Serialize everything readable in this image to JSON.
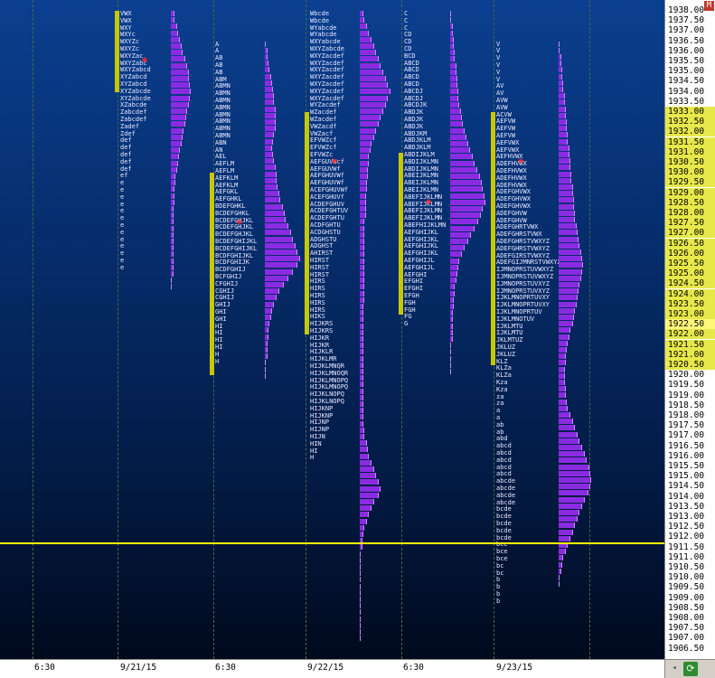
{
  "price_axis": {
    "labels": [
      "1938.00",
      "1937.50",
      "1937.00",
      "1936.50",
      "1936.00",
      "1935.50",
      "1935.00",
      "1934.50",
      "1934.00",
      "1933.50",
      "1933.00",
      "1932.50",
      "1932.00",
      "1931.50",
      "1931.00",
      "1930.50",
      "1930.00",
      "1929.50",
      "1929.00",
      "1928.50",
      "1928.00",
      "1927.50",
      "1927.00",
      "1926.50",
      "1926.00",
      "1925.50",
      "1925.00",
      "1924.50",
      "1924.00",
      "1923.50",
      "1923.00",
      "1922.50",
      "1922.00",
      "1921.50",
      "1921.00",
      "1920.50",
      "1920.00",
      "1919.50",
      "1919.00",
      "1918.50",
      "1918.00",
      "1917.50",
      "1917.00",
      "1916.50",
      "1916.00",
      "1915.50",
      "1915.00",
      "1914.50",
      "1914.00",
      "1913.50",
      "1913.00",
      "1912.50",
      "1912.00",
      "1911.50",
      "1911.00",
      "1910.50",
      "1910.00",
      "1909.50",
      "1909.00",
      "1908.50",
      "1908.00",
      "1907.50",
      "1907.00",
      "1906.50"
    ],
    "highlight_range": [
      "1933.00",
      "1920.50"
    ],
    "current_price": "1922.50",
    "max": 1938.0,
    "step": 0.5
  },
  "time_axis": {
    "labels": [
      "6:30",
      "9/21/15",
      "6:30",
      "9/22/15",
      "6:30",
      "9/23/15"
    ]
  },
  "toolbar": {
    "menu_icon_label": "M"
  },
  "colors": {
    "profile": "#8a2be2",
    "value_area": "#c8c800",
    "last_price": "#ffff00",
    "marker": "#ff3030"
  },
  "last_trade_line_price": 1911.75,
  "sessions": [
    {
      "letters": [
        "VWX",
        "VWX",
        "WXY",
        "WXYc",
        "WXYZc",
        "WXYZc",
        "WXYZac",
        "WXYZabc",
        "WXYZabcd",
        "XYZabcd",
        "XYZabcd",
        "XYZabcde",
        "XYZabcde",
        "XZabcde",
        "Zabcdef",
        "Zabcdef",
        "Zadef",
        "Zdef",
        "def",
        "def",
        "def",
        "def",
        "def",
        "ef",
        "e",
        "e",
        "e",
        "e",
        "e",
        "e",
        "e",
        "e",
        "e",
        "e",
        "e",
        "e",
        "e"
      ],
      "top": 1938.0,
      "va_high": 1938.0,
      "va_low": 1934.0,
      "profile": [
        3,
        3,
        5,
        6,
        8,
        9,
        10,
        12,
        14,
        15,
        15,
        16,
        17,
        16,
        15,
        14,
        13,
        12,
        11,
        10,
        9,
        8,
        7,
        6,
        5,
        4,
        4,
        3,
        3,
        3,
        2,
        2,
        2,
        2,
        2,
        2,
        2,
        2,
        2,
        2,
        2,
        1,
        1
      ]
    },
    {
      "letters": [
        "A",
        "A",
        "AB",
        "AB",
        "AB",
        "ABM",
        "ABMN",
        "ABMN",
        "ABMN",
        "ABMN",
        "ABMN",
        "ABMN",
        "ABMN",
        "ABMN",
        "ABN",
        "AN",
        "AEL",
        "AEFLM",
        "AEFLM",
        "AEFKLM",
        "AEFKLM",
        "AEFGKL",
        "AEFGHKL",
        "BDEFGHKL",
        "BCDEFGHKL",
        "BCDEFGHJKL",
        "BCDEFGHJKL",
        "BCDEFGHJKL",
        "BCDEFGHIJKL",
        "BCDEFGHIJKL",
        "BCDFGHIJKL",
        "BCDFGHIJK",
        "BCDFGHIJ",
        "BCFGHIJ",
        "CFGHIJ",
        "CGHIJ",
        "CGHIJ",
        "GHIJ",
        "GHI",
        "GHI",
        "HI",
        "HI",
        "HI",
        "HI",
        "H",
        "H"
      ],
      "top": 1936.5,
      "va_high": 1930.0,
      "va_low": 1920.0,
      "profile": [
        1,
        2,
        2,
        3,
        4,
        5,
        6,
        7,
        8,
        8,
        9,
        9,
        9,
        9,
        8,
        7,
        6,
        7,
        8,
        9,
        10,
        10,
        11,
        12,
        13,
        15,
        17,
        18,
        20,
        22,
        24,
        26,
        28,
        30,
        28,
        24,
        20,
        16,
        12,
        10,
        8,
        6,
        5,
        4,
        3,
        3,
        2,
        2,
        2,
        1,
        1,
        1
      ]
    },
    {
      "letters": [
        "Wbcde",
        "Wbcde",
        "WYabcde",
        "WYabcde",
        "WXYabcde",
        "WXYZabcde",
        "WXYZacdef",
        "WXYZacdef",
        "WXYZacdef",
        "WXYZacdef",
        "WXYZacdef",
        "WXYZacdef",
        "WXYZacdef",
        "WYZacdef",
        "WZacdef",
        "WZacdef",
        "VWZacdf",
        "VWZacf",
        "EFVWZcf",
        "EFVWZcf",
        "EFVWZc",
        "AEFGUVWcf",
        "AEFGUVWf",
        "AEFGHUVWf",
        "AEFGHUVWf",
        "ACEFGHUVWf",
        "ACEFGHUVf",
        "ACDEFGHUV",
        "ACDEFGHTUV",
        "ACDEFGHTU",
        "ACDFGHTU",
        "ACDGHSTU",
        "ADGHSTU",
        "ADGHST",
        "AHIRST",
        "HIRST",
        "HIRST",
        "HIRST",
        "HIRS",
        "HIRS",
        "HIRS",
        "HIRS",
        "HIRS",
        "HIKS",
        "HIJKRS",
        "HIJKRS",
        "HIJKR",
        "HIJKR",
        "HIJKLR",
        "HIJKLMR",
        "HIJKLMNQR",
        "HIJKLMNOQR",
        "HIJKLMNOPQ",
        "HIJKLMNOPQ",
        "HIJKLNOPQ",
        "HIJKLNOPQ",
        "HIJKNP",
        "HIJKNP",
        "HIJNP",
        "HIJNP",
        "HIJN",
        "HIN",
        "HI",
        "H"
      ],
      "top": 1938.0,
      "va_high": 1933.0,
      "va_low": 1922.0,
      "profile": [
        3,
        4,
        6,
        8,
        10,
        12,
        14,
        16,
        18,
        20,
        22,
        24,
        26,
        24,
        22,
        20,
        18,
        16,
        14,
        12,
        10,
        9,
        8,
        8,
        7,
        7,
        6,
        6,
        5,
        5,
        5,
        5,
        4,
        4,
        4,
        4,
        4,
        4,
        4,
        4,
        4,
        4,
        4,
        4,
        4,
        3,
        3,
        3,
        3,
        3,
        3,
        3,
        3,
        3,
        3,
        3,
        3,
        3,
        3,
        3,
        3,
        3,
        3,
        3,
        4,
        4,
        6,
        7,
        8,
        10,
        12,
        14,
        16,
        18,
        16,
        12,
        10,
        8,
        6,
        4,
        3,
        2,
        2,
        1,
        1,
        1,
        1,
        1,
        1,
        1,
        1,
        1,
        1,
        1,
        1,
        1,
        1
      ]
    },
    {
      "letters": [
        "C",
        "C",
        "C",
        "CD",
        "CD",
        "CD",
        "BCD",
        "ABCD",
        "ABCD",
        "ABCD",
        "ABCD",
        "ABCDJ",
        "ABCDJ",
        "ABCDJK",
        "ABDJK",
        "ABDJK",
        "ABDJK",
        "ABDJKM",
        "ABDJKLM",
        "ABDJKLM",
        "ABDIJKLM",
        "ABDIJKLMN",
        "ABDIJKLMN",
        "ABEIJKLMN",
        "ABEIJKLMN",
        "ABEIJKLMN",
        "ABEFIJKLMN",
        "ABEFIJKLMN",
        "ABEFIJKLMN",
        "ABEFIJKLMN",
        "ABEFHIJKLMN",
        "AEFGHIJKL",
        "AEFGHIJKL",
        "AEFGHIJKL",
        "AEFGHIJKL",
        "AEFGHIJL",
        "AEFGHIJL",
        "AEFGHI",
        "EFGHI",
        "EFGHI",
        "EFGH",
        "FGH",
        "FGH",
        "FG",
        "G"
      ],
      "top": 1938.0,
      "va_high": 1931.0,
      "va_low": 1923.0,
      "profile": [
        1,
        1,
        2,
        2,
        3,
        3,
        4,
        4,
        5,
        5,
        6,
        6,
        7,
        7,
        8,
        9,
        10,
        11,
        12,
        14,
        15,
        17,
        19,
        21,
        23,
        25,
        27,
        28,
        29,
        30,
        28,
        26,
        24,
        21,
        18,
        15,
        12,
        10,
        8,
        7,
        6,
        5,
        4,
        4,
        3,
        3,
        2,
        2,
        2,
        2,
        2,
        1,
        1,
        1,
        1,
        1
      ]
    },
    {
      "letters": [
        "V",
        "V",
        "V",
        "V",
        "V",
        "V",
        "AV",
        "AV",
        "AVW",
        "AVW",
        "ACVW",
        "AEFVW",
        "AEFVW",
        "AEFVW",
        "AEFVWX",
        "AEFVWX",
        "AEFHVWX",
        "ADEFHVWX",
        "ADEFHVWX",
        "ADEFHVWX",
        "ADEFHVWX",
        "ADEFGHVWX",
        "ADEFGHVWX",
        "ADEFGHVWX",
        "ADEFGHVW",
        "ADEFGHVW",
        "ADEFGHRTVWX",
        "ADEFGHRSTVWX",
        "ADEFGHRSTVWXYZ",
        "ADEFGHRSTVWXYZ",
        "ADEFGIRSTVWXYZ",
        "ADEFGIJMNRSTVWXYZ",
        "IJMNOPRSTUVWXYZ",
        "IJMNOPRSTUVWXYZ",
        "IJMNOPRSTUVXYZ",
        "IJMNOPRSTUVXYZ",
        "IJKLMNOPRTUVXY",
        "IJKLMNOPRTUVXY",
        "IJKLMNOPRTUV",
        "IJKLMNOTUV",
        "IJKLMTU",
        "IJKLMTU",
        "JKLMTUZ",
        "JKLUZ",
        "JKLUZ",
        "KLZ",
        "KLZa",
        "KLZa",
        "Kza",
        "Kza",
        "za",
        "za",
        "a",
        "a",
        "ab",
        "ab",
        "abd",
        "abcd",
        "abcd",
        "abcd",
        "abcd",
        "abcd",
        "abcde",
        "abcde",
        "abcde",
        "abcde",
        "bcde",
        "bcde",
        "bcde",
        "bcde",
        "bcde",
        "bce",
        "bce",
        "bce",
        "bc",
        "bc",
        "b",
        "b",
        "b",
        "b"
      ],
      "top": 1936.5,
      "va_high": 1933.0,
      "va_low": 1920.5,
      "profile": [
        1,
        1,
        2,
        2,
        3,
        3,
        4,
        4,
        5,
        5,
        6,
        6,
        7,
        7,
        8,
        8,
        9,
        9,
        10,
        10,
        11,
        11,
        12,
        12,
        13,
        13,
        14,
        14,
        15,
        16,
        17,
        18,
        19,
        20,
        21,
        20,
        19,
        18,
        17,
        16,
        15,
        14,
        13,
        12,
        10,
        9,
        8,
        7,
        6,
        6,
        5,
        5,
        5,
        6,
        6,
        7,
        8,
        10,
        12,
        14,
        16,
        18,
        20,
        22,
        24,
        26,
        27,
        28,
        27,
        25,
        22,
        20,
        18,
        16,
        14,
        12,
        10,
        8,
        6,
        4,
        3,
        2,
        1,
        1
      ]
    }
  ]
}
